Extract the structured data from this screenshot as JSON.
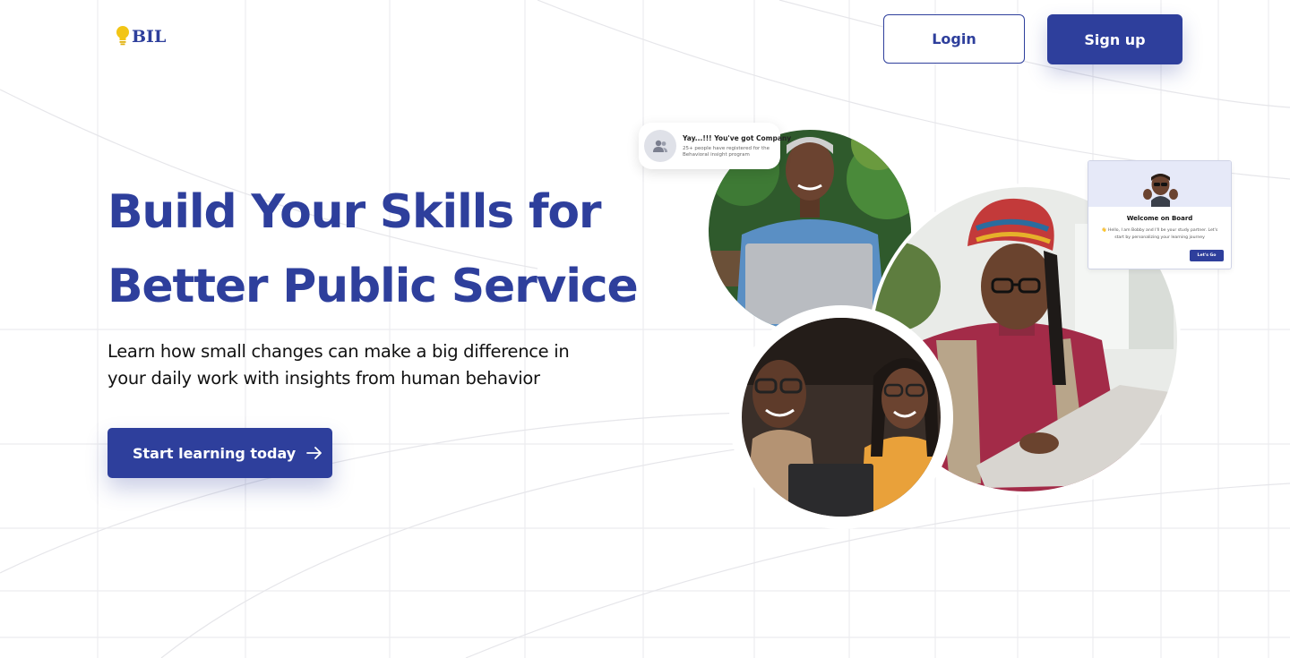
{
  "brand": {
    "logo_text": "BIL",
    "accent": "#2e3f9c",
    "bulb_color": "#f2c515"
  },
  "header": {
    "login_label": "Login",
    "signup_label": "Sign up"
  },
  "hero": {
    "title_line1": "Build Your Skills for",
    "title_line2": "Better Public Service",
    "subtitle_line1": "Learn how small changes can make a big difference in",
    "subtitle_line2": "your daily work with insights from human behavior",
    "cta_label": "Start learning today",
    "cta_icon": "arrow-right-icon"
  },
  "notification": {
    "title": "Yay...!!! You've got Company",
    "description": "25+ people have registered for the Behavioral insight program",
    "icon": "users-icon"
  },
  "welcome_card": {
    "title": "Welcome on Board",
    "message": "👋 Hello, I am Bobby and I'll be your study partner. Let's start by personalizing your learning journey",
    "button_label": "Let's Go"
  },
  "photos": [
    {
      "name": "man-with-laptop-photo"
    },
    {
      "name": "woman-with-headwrap-photo"
    },
    {
      "name": "couple-with-laptop-photo"
    }
  ]
}
